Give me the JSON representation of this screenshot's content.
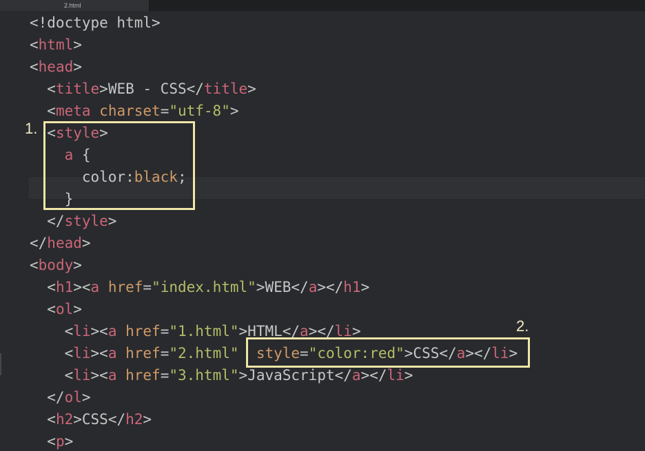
{
  "tab": {
    "label": "2.html"
  },
  "code_lines": [
    [
      [
        "p",
        "<!doctype html>"
      ]
    ],
    [
      [
        "p",
        "<"
      ],
      [
        "t",
        "html"
      ],
      [
        "p",
        ">"
      ]
    ],
    [
      [
        "p",
        "<"
      ],
      [
        "t",
        "head"
      ],
      [
        "p",
        ">"
      ]
    ],
    [
      [
        "p",
        "  <"
      ],
      [
        "t",
        "title"
      ],
      [
        "p",
        ">"
      ],
      [
        "x",
        "WEB - CSS"
      ],
      [
        "p",
        "</"
      ],
      [
        "t",
        "title"
      ],
      [
        "p",
        ">"
      ]
    ],
    [
      [
        "p",
        "  <"
      ],
      [
        "t",
        "meta"
      ],
      [
        "p",
        " "
      ],
      [
        "a",
        "charset"
      ],
      [
        "p",
        "="
      ],
      [
        "s",
        "\"utf-8\""
      ],
      [
        "p",
        ">"
      ]
    ],
    [
      [
        "p",
        "  <"
      ],
      [
        "t",
        "style"
      ],
      [
        "p",
        ">"
      ]
    ],
    [
      [
        "p",
        "    "
      ],
      [
        "t",
        "a"
      ],
      [
        "p",
        " {"
      ]
    ],
    [
      [
        "p",
        "      color:"
      ],
      [
        "a",
        "black"
      ],
      [
        "p",
        ";"
      ]
    ],
    [
      [
        "p",
        "    }"
      ]
    ],
    [
      [
        "p",
        "  </"
      ],
      [
        "t",
        "style"
      ],
      [
        "p",
        ">"
      ]
    ],
    [
      [
        "p",
        "</"
      ],
      [
        "t",
        "head"
      ],
      [
        "p",
        ">"
      ]
    ],
    [
      [
        "p",
        "<"
      ],
      [
        "t",
        "body"
      ],
      [
        "p",
        ">"
      ]
    ],
    [
      [
        "p",
        "  <"
      ],
      [
        "t",
        "h1"
      ],
      [
        "p",
        "><"
      ],
      [
        "t",
        "a"
      ],
      [
        "p",
        " "
      ],
      [
        "a",
        "href"
      ],
      [
        "p",
        "="
      ],
      [
        "s",
        "\"index.html\""
      ],
      [
        "p",
        ">"
      ],
      [
        "x",
        "WEB"
      ],
      [
        "p",
        "</"
      ],
      [
        "t",
        "a"
      ],
      [
        "p",
        "></"
      ],
      [
        "t",
        "h1"
      ],
      [
        "p",
        ">"
      ]
    ],
    [
      [
        "p",
        "  <"
      ],
      [
        "t",
        "ol"
      ],
      [
        "p",
        ">"
      ]
    ],
    [
      [
        "p",
        "    <"
      ],
      [
        "t",
        "li"
      ],
      [
        "p",
        "><"
      ],
      [
        "t",
        "a"
      ],
      [
        "p",
        " "
      ],
      [
        "a",
        "href"
      ],
      [
        "p",
        "="
      ],
      [
        "s",
        "\"1.html\""
      ],
      [
        "p",
        ">"
      ],
      [
        "x",
        "HTML"
      ],
      [
        "p",
        "</"
      ],
      [
        "t",
        "a"
      ],
      [
        "p",
        "></"
      ],
      [
        "t",
        "li"
      ],
      [
        "p",
        ">"
      ]
    ],
    [
      [
        "p",
        "    <"
      ],
      [
        "t",
        "li"
      ],
      [
        "p",
        "><"
      ],
      [
        "t",
        "a"
      ],
      [
        "p",
        " "
      ],
      [
        "a",
        "href"
      ],
      [
        "p",
        "="
      ],
      [
        "s",
        "\"2.html\""
      ],
      [
        "p",
        "  "
      ],
      [
        "a",
        "style"
      ],
      [
        "p",
        "="
      ],
      [
        "s",
        "\"color:red\""
      ],
      [
        "p",
        ">"
      ],
      [
        "x",
        "CSS"
      ],
      [
        "p",
        "</"
      ],
      [
        "t",
        "a"
      ],
      [
        "p",
        "></"
      ],
      [
        "t",
        "li"
      ],
      [
        "p",
        ">"
      ]
    ],
    [
      [
        "p",
        "    <"
      ],
      [
        "t",
        "li"
      ],
      [
        "p",
        "><"
      ],
      [
        "t",
        "a"
      ],
      [
        "p",
        " "
      ],
      [
        "a",
        "href"
      ],
      [
        "p",
        "="
      ],
      [
        "s",
        "\"3.html\""
      ],
      [
        "p",
        ">"
      ],
      [
        "x",
        "JavaScript"
      ],
      [
        "p",
        "</"
      ],
      [
        "t",
        "a"
      ],
      [
        "p",
        "></"
      ],
      [
        "t",
        "li"
      ],
      [
        "p",
        ">"
      ]
    ],
    [
      [
        "p",
        "  </"
      ],
      [
        "t",
        "ol"
      ],
      [
        "p",
        ">"
      ]
    ],
    [
      [
        "p",
        "  <"
      ],
      [
        "t",
        "h2"
      ],
      [
        "p",
        ">"
      ],
      [
        "x",
        "CSS"
      ],
      [
        "p",
        "</"
      ],
      [
        "t",
        "h2"
      ],
      [
        "p",
        ">"
      ]
    ],
    [
      [
        "p",
        "  <"
      ],
      [
        "t",
        "p"
      ],
      [
        "p",
        ">"
      ]
    ]
  ],
  "annotations": {
    "marker_1": "1.",
    "marker_2": "2."
  },
  "colors": {
    "background": "#282a2e",
    "punctuation": "#c5c8c6",
    "tag": "#cc6677",
    "attribute": "#d19a66",
    "string": "#b5bd68",
    "highlight_box": "#efe6a6"
  }
}
